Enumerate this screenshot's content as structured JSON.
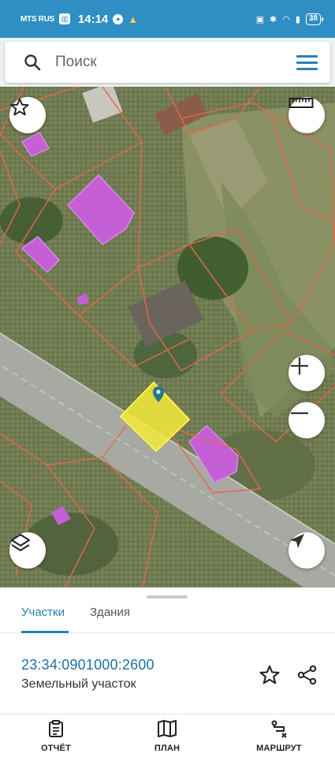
{
  "statusbar": {
    "carrier": "MTS RUS",
    "network": "VoLTE",
    "time": "14:14",
    "battery": "38"
  },
  "search": {
    "placeholder": "Поиск"
  },
  "map": {
    "selected_parcel_color": "#f3ea3a",
    "boundary_color": "#e8664a",
    "building_highlight_color": "#c45fd6",
    "buttons": [
      "favorite-icon",
      "ruler-icon",
      "zoom-in-icon",
      "zoom-out-icon",
      "layers-icon",
      "locate-icon"
    ]
  },
  "tabs": {
    "active": "Участки",
    "inactive": "Здания"
  },
  "parcel": {
    "cadastral_number": "23:34:0901000:2600",
    "type": "Земельный участок"
  },
  "nav": {
    "report": "ОТЧЁТ",
    "plan": "ПЛАН",
    "route": "МАРШРУТ"
  }
}
